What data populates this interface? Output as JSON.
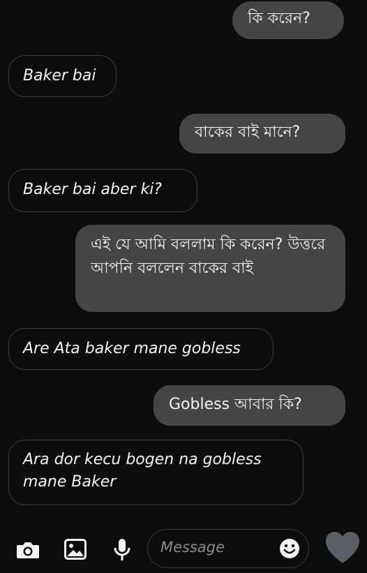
{
  "messages": [
    {
      "direction": "outgoing",
      "text": "কি করেন?"
    },
    {
      "direction": "incoming",
      "text": "Baker bai"
    },
    {
      "direction": "outgoing",
      "text": "বাকের বাই মানে?"
    },
    {
      "direction": "incoming",
      "text": "Baker bai aber ki?"
    },
    {
      "direction": "outgoing",
      "text": "এই যে আমি বললাম কি করেন? উত্তরে আপনি বললেন বাকের বাই"
    },
    {
      "direction": "incoming",
      "text": "Are Ata baker mane gobless"
    },
    {
      "direction": "outgoing",
      "text": "Gobless আবার কি?"
    },
    {
      "direction": "incoming",
      "text": "Ara dor kecu bogen na gobless mane Baker"
    }
  ],
  "composer": {
    "placeholder": "Message",
    "icons": [
      "camera-icon",
      "gallery-icon",
      "microphone-icon",
      "emoji-icon",
      "heart-icon"
    ]
  },
  "colors": {
    "background": "#0d0d0d",
    "outgoing_bubble": "#454545",
    "incoming_border": "#3d3d3d",
    "text": "#f2f2f2"
  }
}
